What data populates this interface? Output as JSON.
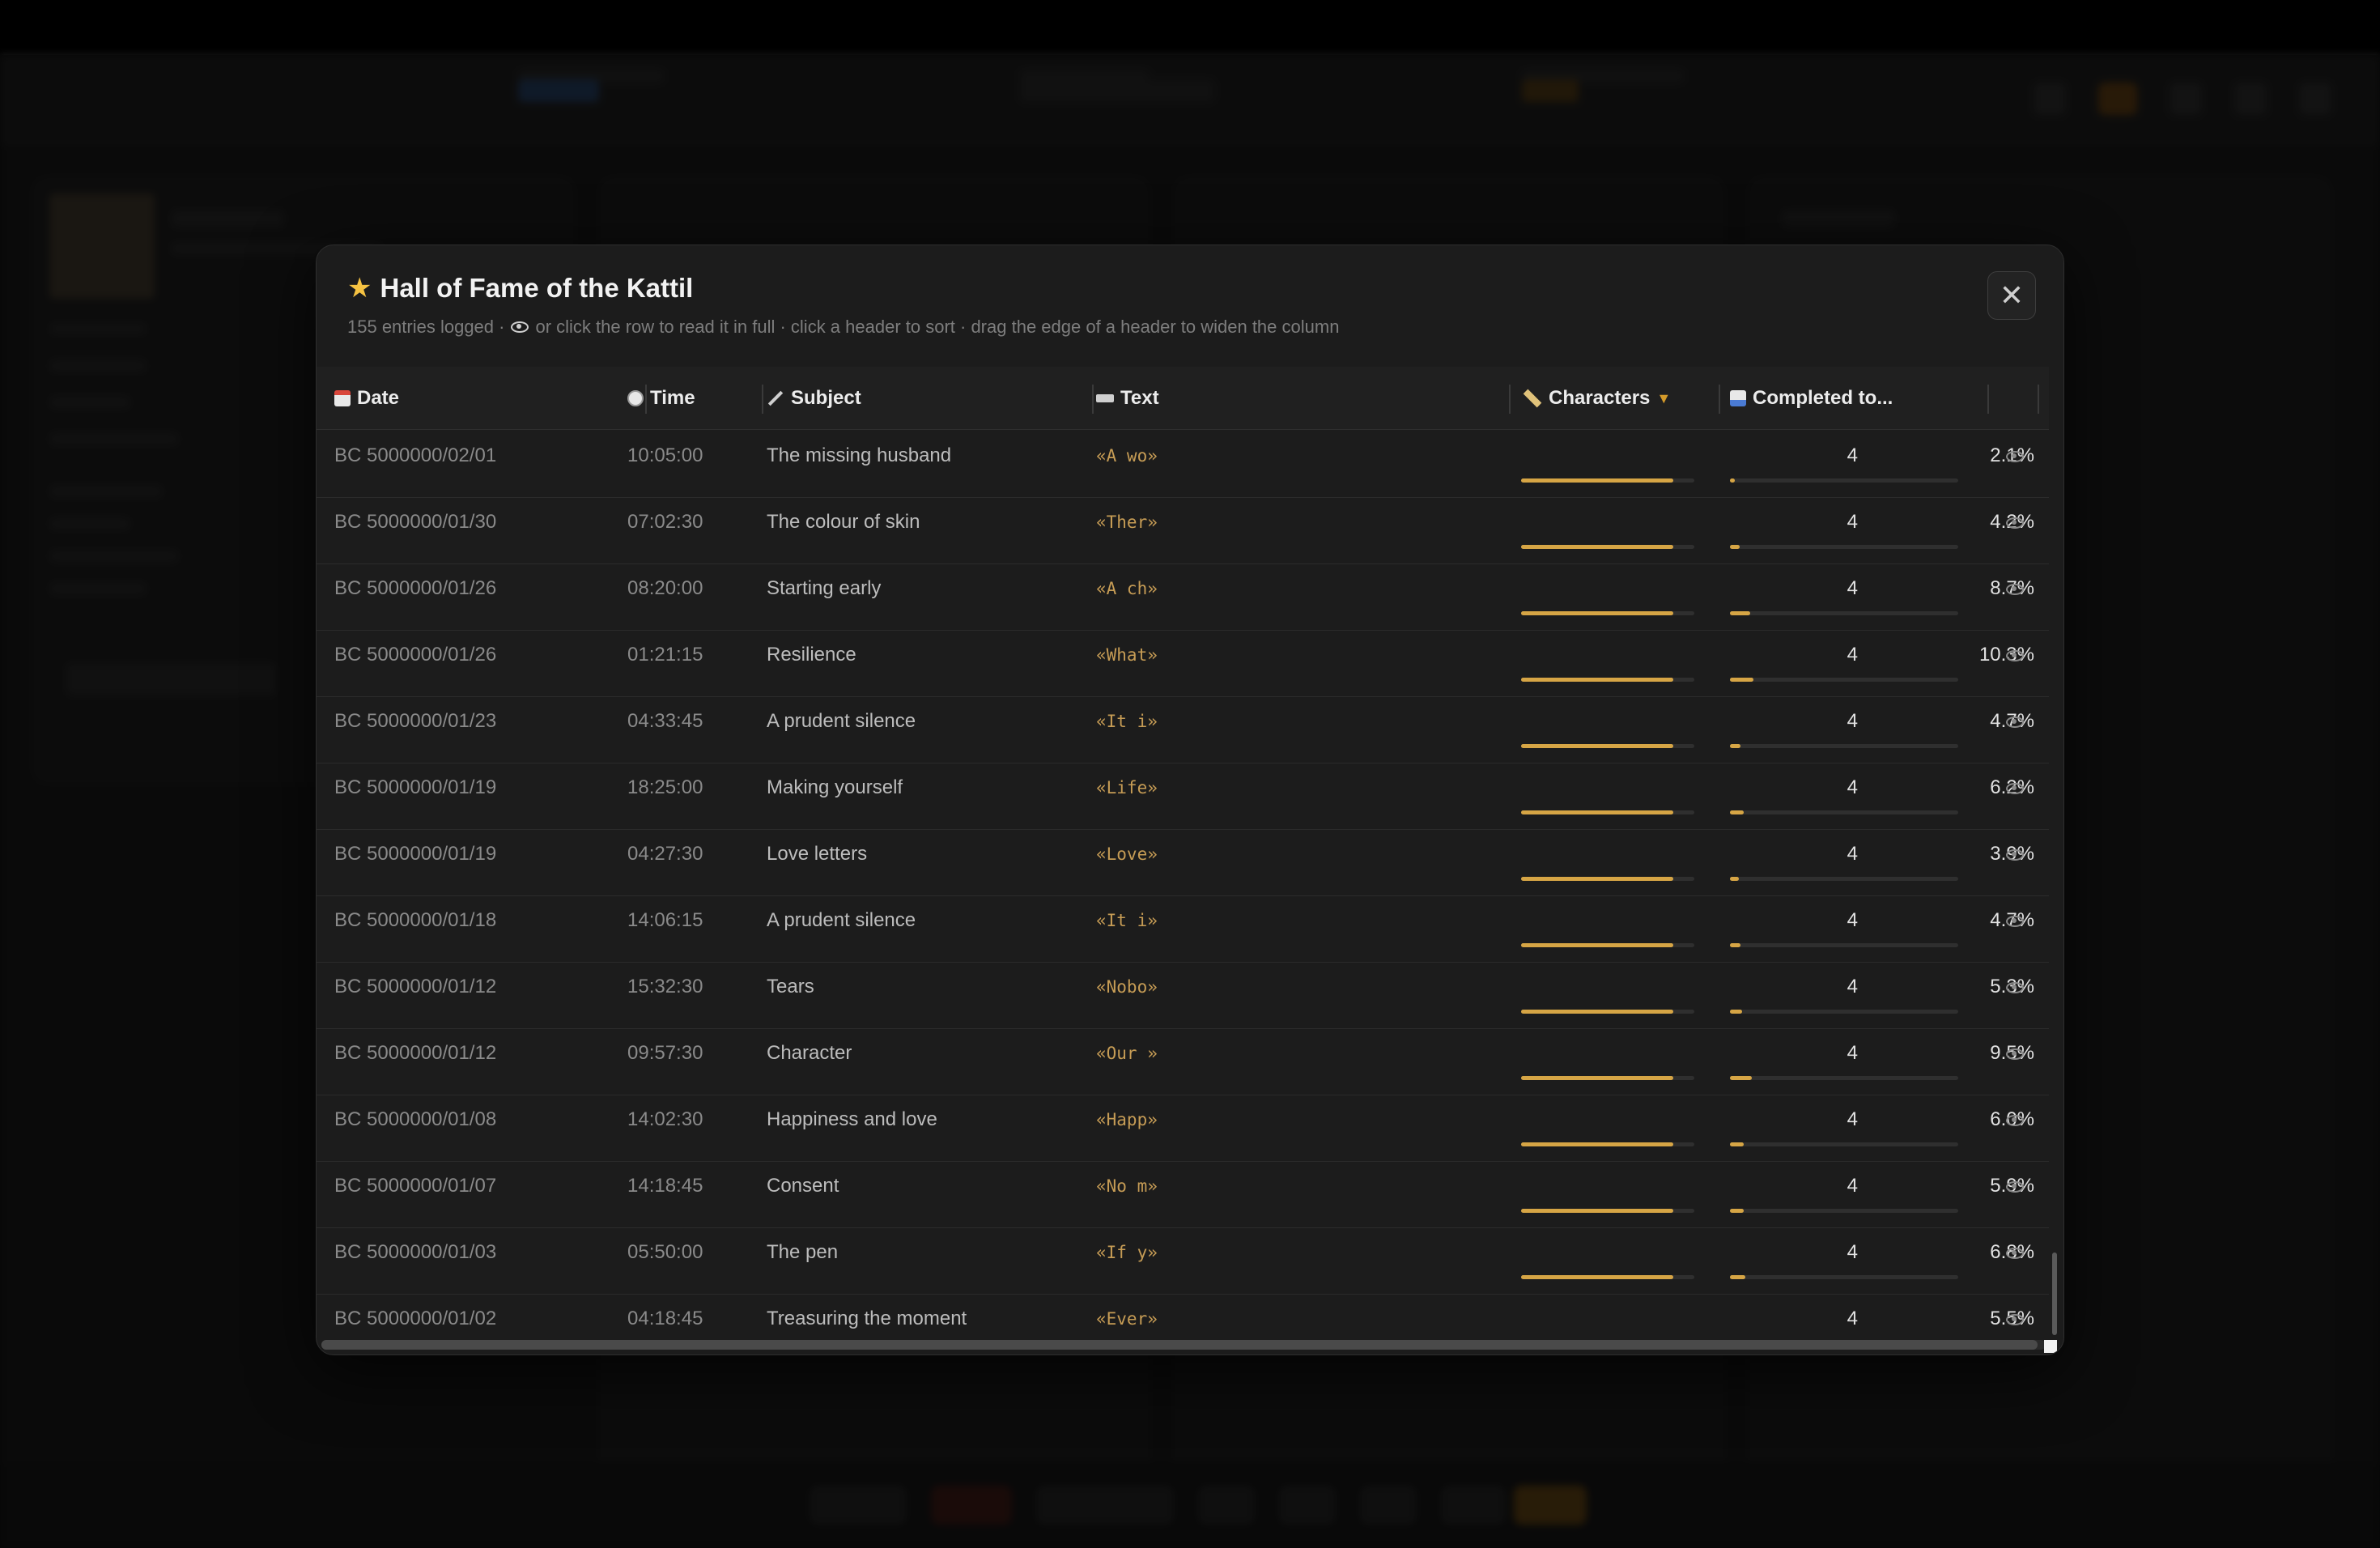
{
  "modal": {
    "title": "Hall of Fame of the Kattil",
    "subtitle_pre": "155 entries logged ·",
    "subtitle_post": "or click the row to read it in full · click a header to sort · drag the edge of a header to widen the column",
    "close_label": "✕"
  },
  "table": {
    "headers": {
      "date": "Date",
      "time": "Time",
      "subject": "Subject",
      "text": "Text",
      "characters": "Characters",
      "completed": "Completed to..."
    },
    "sort_indicator": "▼",
    "rows": [
      {
        "date": "BC 5000000/02/01",
        "time": "10:05:00",
        "subject": "The missing husband",
        "text": "«A wo»",
        "chars": "4",
        "chars_fill": 0.88,
        "pct": "2.1%",
        "pct_value": 0.021
      },
      {
        "date": "BC 5000000/01/30",
        "time": "07:02:30",
        "subject": "The colour of skin",
        "text": "«Ther»",
        "chars": "4",
        "chars_fill": 0.88,
        "pct": "4.2%",
        "pct_value": 0.042
      },
      {
        "date": "BC 5000000/01/26",
        "time": "08:20:00",
        "subject": "Starting early",
        "text": "«A ch»",
        "chars": "4",
        "chars_fill": 0.88,
        "pct": "8.7%",
        "pct_value": 0.087
      },
      {
        "date": "BC 5000000/01/26",
        "time": "01:21:15",
        "subject": "Resilience",
        "text": "«What»",
        "chars": "4",
        "chars_fill": 0.88,
        "pct": "10.3%",
        "pct_value": 0.103
      },
      {
        "date": "BC 5000000/01/23",
        "time": "04:33:45",
        "subject": "A prudent silence",
        "text": "«It i»",
        "chars": "4",
        "chars_fill": 0.88,
        "pct": "4.7%",
        "pct_value": 0.047
      },
      {
        "date": "BC 5000000/01/19",
        "time": "18:25:00",
        "subject": "Making yourself",
        "text": "«Life»",
        "chars": "4",
        "chars_fill": 0.88,
        "pct": "6.2%",
        "pct_value": 0.062
      },
      {
        "date": "BC 5000000/01/19",
        "time": "04:27:30",
        "subject": "Love letters",
        "text": "«Love»",
        "chars": "4",
        "chars_fill": 0.88,
        "pct": "3.9%",
        "pct_value": 0.039
      },
      {
        "date": "BC 5000000/01/18",
        "time": "14:06:15",
        "subject": "A prudent silence",
        "text": "«It i»",
        "chars": "4",
        "chars_fill": 0.88,
        "pct": "4.7%",
        "pct_value": 0.047
      },
      {
        "date": "BC 5000000/01/12",
        "time": "15:32:30",
        "subject": "Tears",
        "text": "«Nobo»",
        "chars": "4",
        "chars_fill": 0.88,
        "pct": "5.3%",
        "pct_value": 0.053
      },
      {
        "date": "BC 5000000/01/12",
        "time": "09:57:30",
        "subject": "Character",
        "text": "«Our »",
        "chars": "4",
        "chars_fill": 0.88,
        "pct": "9.5%",
        "pct_value": 0.095
      },
      {
        "date": "BC 5000000/01/08",
        "time": "14:02:30",
        "subject": "Happiness and love",
        "text": "«Happ»",
        "chars": "4",
        "chars_fill": 0.88,
        "pct": "6.0%",
        "pct_value": 0.06
      },
      {
        "date": "BC 5000000/01/07",
        "time": "14:18:45",
        "subject": "Consent",
        "text": "«No m»",
        "chars": "4",
        "chars_fill": 0.88,
        "pct": "5.9%",
        "pct_value": 0.059
      },
      {
        "date": "BC 5000000/01/03",
        "time": "05:50:00",
        "subject": "The pen",
        "text": "«If y»",
        "chars": "4",
        "chars_fill": 0.88,
        "pct": "6.8%",
        "pct_value": 0.068
      },
      {
        "date": "BC 5000000/01/02",
        "time": "04:18:45",
        "subject": "Treasuring the moment",
        "text": "«Ever»",
        "chars": "4",
        "chars_fill": 0.88,
        "pct": "5.5%",
        "pct_value": 0.055
      }
    ]
  },
  "colors": {
    "accent": "#d6a545",
    "background": "#1c1c1c",
    "text_mono": "#c69c55"
  }
}
